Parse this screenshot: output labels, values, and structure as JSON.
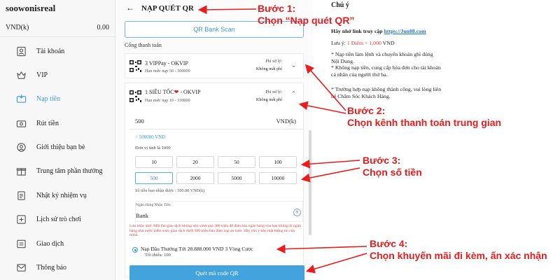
{
  "sidebar": {
    "username": "soowonisreal",
    "balance_label": "VND(k)",
    "balance_value": "0.00",
    "items": [
      {
        "label": "Tài khoản",
        "icon": "user-icon"
      },
      {
        "label": "VIP",
        "icon": "crown-icon"
      },
      {
        "label": "Nạp tiền",
        "icon": "deposit-icon",
        "active": true
      },
      {
        "label": "Rút tiền",
        "icon": "withdraw-icon"
      },
      {
        "label": "Giới thiệu bạn bè",
        "icon": "referral-icon"
      },
      {
        "label": "Trung tâm phần thưởng",
        "icon": "gift-icon"
      },
      {
        "label": "Nhật ký nhiệm vụ",
        "icon": "task-log-icon"
      },
      {
        "label": "Lịch sử trò chơi",
        "icon": "game-history-icon"
      },
      {
        "label": "Giao dịch",
        "icon": "transaction-icon"
      },
      {
        "label": "Thông báo",
        "icon": "bell-icon"
      }
    ]
  },
  "header": {
    "back_icon": "←",
    "title": "NẠP QUÉT QR"
  },
  "bank_scan_button": "QR Bank Scan",
  "payment_section_label": "Cổng thanh toán",
  "channels": [
    {
      "title": "3 VIPPay - OKVIP",
      "limit": "Hạn mức nạp 50 - 300000",
      "fee_label": "Phí xử lý:",
      "fee_value": "Không mất phí",
      "expanded": false
    },
    {
      "title_prefix": "1 SIÊU TỐC",
      "heart": "❤",
      "title_suffix": " - OKVIP",
      "limit": "Hạn mức nạp 10 - 330000",
      "fee_label": "Phí xử lý:",
      "fee_value": "Không mất phí",
      "expanded": true
    }
  ],
  "amount": {
    "value": "500",
    "currency": "VND(k)",
    "converted": "= 500000 VND",
    "unit_note": "Đơn vị tính là 1000",
    "options": [
      "10",
      "20",
      "50",
      "100",
      "500",
      "2000",
      "5000",
      "10000"
    ],
    "selected": "500",
    "receive_note": "Số tiền bạn nhận được : 500.00 VND(k)"
  },
  "bank": {
    "label": "Ngân Hàng Nhận Tiền",
    "value": "Bank"
  },
  "warning_note": "Lưu nhắc nhở: Mỗi lần giao dịch không nên vượt quá 300 triệu để đảm bảo ngân hàng của bạn không bị ngân hàng nhà nước kiểm soát, giao dịch dưới 300 triệu bảo đảm nạp an toàn. Hãy chú ý bảo mật thông tin của mình.",
  "promotion": {
    "title": "Nạp Đầu Thưởng Tới 28.888.000 VND 3 Vòng Cược",
    "subtitle": "Tối thiểu: 100"
  },
  "confirm_button": "Quét mã code QR",
  "notes": {
    "title": "Chú ý",
    "link_prefix": "Hãy nhớ link truy cập ",
    "link_text": "https://Jun88.com",
    "line2_prefix": "Lưu ý: ",
    "line2_red": "1 Điểm = 1,000",
    "line2_suffix": " VND",
    "line3": "* Nạp tiền làm lệnh và chuyển khoản ghi đúng Nội Dung.",
    "line4": "* Không nạp tiền, cung cấp hóa đơn cho tài khoản cá nhân của người thứ ba.",
    "line5": "* Trường hợp nạp không thành công, vui lòng liên hệ Chăm Sóc Khách Hàng."
  },
  "annotations": {
    "step1_title": "Bước 1:",
    "step1_text": "Chọn “Nạp quét QR”",
    "step2_title": "Bước 2:",
    "step2_text": "Chọn kênh thanh toán trung gian",
    "step3_title": "Bước 3:",
    "step3_text": "Chọn số tiền",
    "step4_title": "Bước 4:",
    "step4_text": "Chọn khuyến mãi đi kèm, ấn xác nhận",
    "color": "#ea1c1c"
  },
  "colors": {
    "accent": "#43a3dd",
    "link": "#1e74c8",
    "warning": "#d63a3a"
  }
}
